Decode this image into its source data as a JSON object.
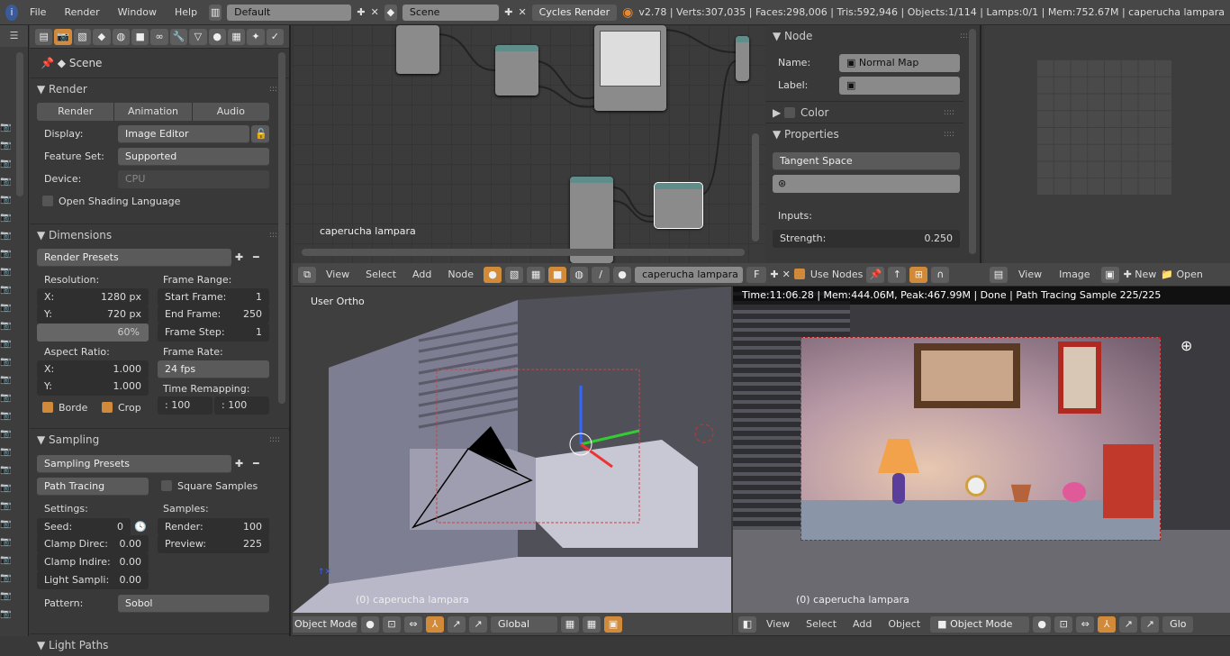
{
  "topbar": {
    "menus": [
      "File",
      "Render",
      "Window",
      "Help"
    ],
    "screen": "Default",
    "scene": "Scene",
    "engine": "Cycles Render",
    "stats": "v2.78 | Verts:307,035 | Faces:298,006 | Tris:592,946 | Objects:1/114 | Lamps:0/1 | Mem:752.67M | caperucha lampara"
  },
  "properties": {
    "context": "Scene",
    "render": {
      "title": "Render",
      "buttons": [
        "Render",
        "Animation",
        "Audio"
      ],
      "display_label": "Display:",
      "display": "Image Editor",
      "feature_label": "Feature Set:",
      "feature": "Supported",
      "device_label": "Device:",
      "device": "CPU",
      "osl": "Open Shading Language"
    },
    "dimensions": {
      "title": "Dimensions",
      "presets": "Render Presets",
      "resolution": "Resolution:",
      "x_label": "X:",
      "x": "1280 px",
      "y_label": "Y:",
      "y": "720 px",
      "percent": "60%",
      "aspect": "Aspect Ratio:",
      "ax": "1.000",
      "ay": "1.000",
      "border": "Borde",
      "crop": "Crop",
      "frame_range": "Frame Range:",
      "start": "Start Frame:",
      "start_v": "1",
      "end": "End Frame:",
      "end_v": "250",
      "step": "Frame Step:",
      "step_v": "1",
      "frame_rate": "Frame Rate:",
      "fps": "24 fps",
      "remap": "Time Remapping:",
      "remap_old": ": 100",
      "remap_new": ": 100"
    },
    "sampling": {
      "title": "Sampling",
      "presets": "Sampling Presets",
      "integrator": "Path Tracing",
      "square": "Square Samples",
      "settings": "Settings:",
      "seed": "Seed:",
      "seed_v": "0",
      "clamp_direct": "Clamp Direc:",
      "clamp_direct_v": "0.00",
      "clamp_indirect": "Clamp Indire:",
      "clamp_indirect_v": "0.00",
      "light_sample": "Light Sampli:",
      "light_sample_v": "0.00",
      "samples": "Samples:",
      "render": "Render:",
      "render_v": "100",
      "preview": "Preview:",
      "preview_v": "225",
      "pattern_label": "Pattern:",
      "pattern": "Sobol"
    },
    "light_paths": "Light Paths"
  },
  "node_editor": {
    "label": "caperucha lampara",
    "menus": [
      "View",
      "Select",
      "Add",
      "Node"
    ],
    "material": "caperucha lampara",
    "fake_user": "F",
    "use_nodes": "Use Nodes",
    "npanel": {
      "node_title": "Node",
      "name_label": "Name:",
      "name": "Normal Map",
      "label_label": "Label:",
      "label": "",
      "color": "Color",
      "properties": "Properties",
      "space": "Tangent Space",
      "inputs": "Inputs:",
      "strength_label": "Strength:",
      "strength": "0.250"
    }
  },
  "image_editor": {
    "menus": [
      "View",
      "Image"
    ],
    "new": "New",
    "open": "Open"
  },
  "viewport": {
    "label": "User Ortho",
    "object": "(0) caperucha lampara",
    "mode": "Object Mode",
    "orientation": "Global"
  },
  "render_view": {
    "status": "Time:11:06.28 | Mem:444.06M, Peak:467.99M | Done | Path Tracing Sample 225/225",
    "object": "(0) caperucha lampara",
    "menus": [
      "View",
      "Select",
      "Add",
      "Object"
    ],
    "mode": "Object Mode",
    "orientation": "Glo"
  },
  "colors": {
    "accent": "#d08a3a",
    "header": "#474747",
    "panel": "#393939"
  }
}
